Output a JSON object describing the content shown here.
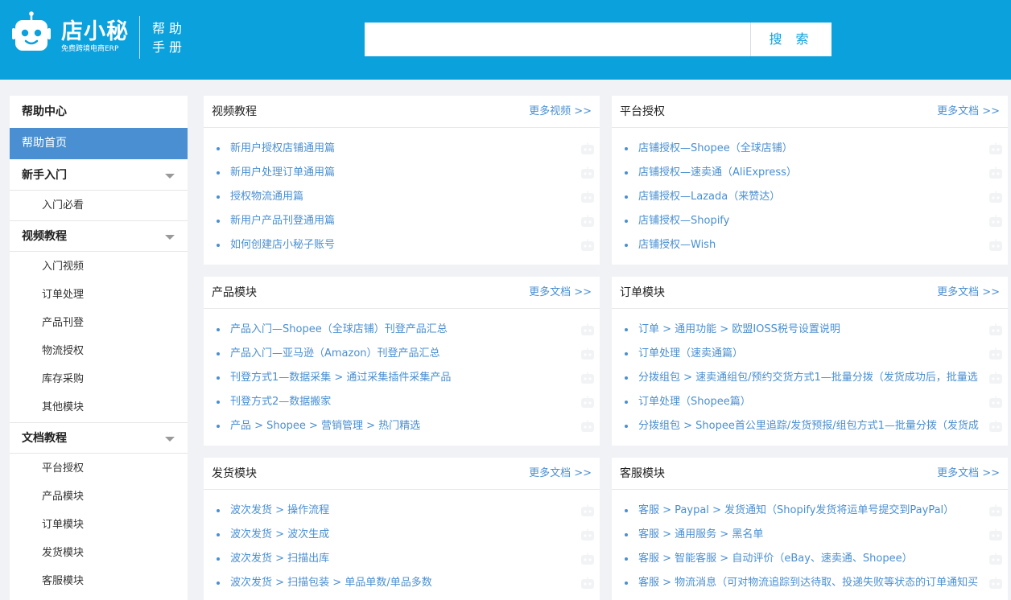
{
  "header": {
    "logo_name": "店小秘",
    "logo_sub": "免费跨境电商ERP",
    "help_line1": "帮助",
    "help_line2": "手册",
    "search": {
      "value": "",
      "placeholder": "",
      "button_label": "搜 索"
    },
    "bg_color": "#0ba1dd"
  },
  "sidebar": {
    "title": "帮助中心",
    "active_item": "帮助首页",
    "sections": [
      {
        "label": "新手入门",
        "items": [
          "入门必看"
        ]
      },
      {
        "label": "视频教程",
        "items": [
          "入门视频",
          "订单处理",
          "产品刊登",
          "物流授权",
          "库存采购",
          "其他模块"
        ]
      },
      {
        "label": "文档教程",
        "items": [
          "平台授权",
          "产品模块",
          "订单模块",
          "发货模块",
          "客服模块"
        ]
      }
    ]
  },
  "cards": [
    {
      "title": "视频教程",
      "more": "更多视频 >>",
      "items": [
        "新用户授权店铺通用篇",
        "新用户处理订单通用篇",
        "授权物流通用篇",
        "新用户产品刊登通用篇",
        "如何创建店小秘子账号"
      ]
    },
    {
      "title": "平台授权",
      "more": "更多文档 >>",
      "items": [
        "店铺授权—Shopee（全球店铺）",
        "店铺授权—速卖通（AliExpress）",
        "店铺授权—Lazada（来赞达）",
        "店铺授权—Shopify",
        "店铺授权—Wish"
      ]
    },
    {
      "title": "产品模块",
      "more": "更多文档 >>",
      "items": [
        "产品入门—Shopee（全球店铺）刊登产品汇总",
        "产品入门—亚马逊（Amazon）刊登产品汇总",
        "刊登方式1—数据采集 > 通过采集插件采集产品",
        "刊登方式2—数据搬家",
        "产品 > Shopee > 营销管理 > 热门精选"
      ]
    },
    {
      "title": "订单模块",
      "more": "更多文档 >>",
      "items": [
        "订单 > 通用功能 > 欧盟IOSS税号设置说明",
        "订单处理（速卖通篇）",
        "分拨组包 > 速卖通组包/预约交货方式1—批量分拨（发货成功后，批量选",
        "订单处理（Shopee篇）",
        "分拨组包 > Shopee首公里追踪/发货预报/组包方式1—批量分拨（发货成"
      ]
    },
    {
      "title": "发货模块",
      "more": "更多文档 >>",
      "items": [
        "波次发货 > 操作流程",
        "波次发货 > 波次生成",
        "波次发货 > 扫描出库",
        "波次发货 > 扫描包装 > 单品单数/单品多数"
      ]
    },
    {
      "title": "客服模块",
      "more": "更多文档 >>",
      "items": [
        "客服 > Paypal > 发货通知（Shopify发货将运单号提交到PayPal）",
        "客服 > 通用服务 > 黑名单",
        "客服 > 智能客服 > 自动评价（eBay、速卖通、Shopee）",
        "客服 > 物流消息（可对物流追踪到达待取、投递失败等状态的订单通知买"
      ]
    }
  ],
  "colors": {
    "accent": "#0ba1dd",
    "link": "#4a8fd1",
    "active": "#4a8fd1"
  }
}
